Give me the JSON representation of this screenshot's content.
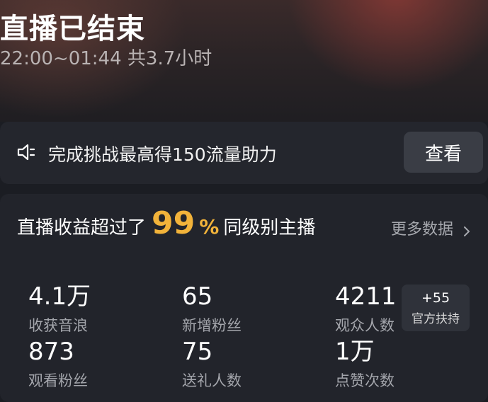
{
  "header": {
    "title": "直播已结束",
    "time_range": "22:00~01:44 共3.7小时"
  },
  "challenge": {
    "icon": "speaker-icon",
    "text": "完成挑战最高得150流量助力",
    "view_button": "查看"
  },
  "summary": {
    "prefix": "直播收益超过了",
    "percent": "99",
    "percent_sign": "%",
    "suffix": "同级别主播",
    "more_link": "更多数据",
    "more_icon": "chevron-right-icon",
    "accent_color": "#f2b33a"
  },
  "stats": [
    {
      "value": "4.1万",
      "label": "收获音浪"
    },
    {
      "value": "65",
      "label": "新增粉丝"
    },
    {
      "value": "4211",
      "label": "观众人数"
    },
    {
      "value": "873",
      "label": "观看粉丝"
    },
    {
      "value": "75",
      "label": "送礼人数"
    },
    {
      "value": "1万",
      "label": "点赞次数"
    }
  ],
  "official_support": {
    "value": "+55",
    "label": "官方扶持"
  }
}
